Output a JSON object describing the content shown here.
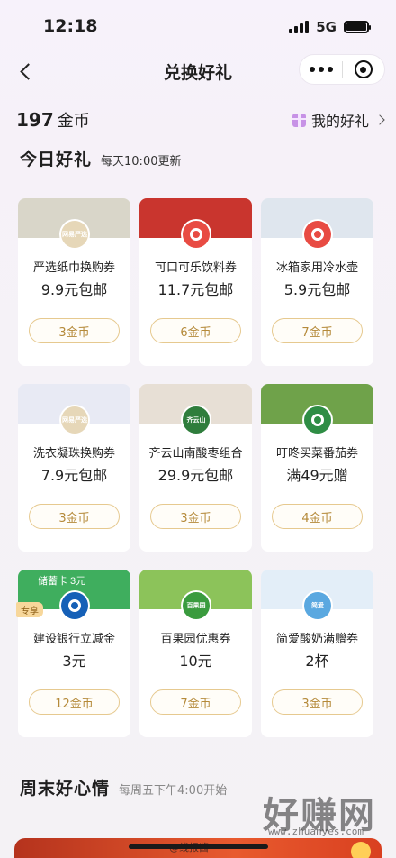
{
  "status_bar": {
    "time": "12:18",
    "network": "5G"
  },
  "nav": {
    "title": "兑换好礼"
  },
  "balance": {
    "amount": "197",
    "unit": "金币"
  },
  "my_gifts": {
    "label": "我的好礼"
  },
  "today": {
    "title": "今日好礼",
    "subtitle": "每天10:00更新"
  },
  "items": [
    {
      "name": "严选纸巾换购券",
      "price": "9.9元包邮",
      "cost": "3金币",
      "img_color": "#d9d6c9",
      "logo_color": "#e6d7b8",
      "logo": "网易严选"
    },
    {
      "name": "可口可乐饮料券",
      "price": "11.7元包邮",
      "cost": "6金币",
      "img_color": "#c9352e",
      "logo_color": "#e84b43",
      "logo": ""
    },
    {
      "name": "冰箱家用冷水壶",
      "price": "5.9元包邮",
      "cost": "7金币",
      "img_color": "#dfe6ee",
      "logo_color": "#e84b43",
      "logo": ""
    },
    {
      "name": "洗衣凝珠换购券",
      "price": "7.9元包邮",
      "cost": "3金币",
      "img_color": "#e8eaf4",
      "logo_color": "#e6d7b8",
      "logo": "网易严选"
    },
    {
      "name": "齐云山南酸枣组合",
      "price": "29.9元包邮",
      "cost": "3金币",
      "img_color": "#e7dfd5",
      "logo_color": "#2f7d3c",
      "logo": "齐云山"
    },
    {
      "name": "叮咚买菜番茄券",
      "price": "满49元赠",
      "cost": "4金币",
      "img_color": "#6fa24a",
      "logo_color": "#2f8d45",
      "logo": ""
    },
    {
      "name": "建设银行立减金",
      "price": "3元",
      "cost": "12金币",
      "img_color": "#3fae5e",
      "logo_color": "#1560b7",
      "logo": "",
      "tag": "专享",
      "img_text": "储蓄卡 3元"
    },
    {
      "name": "百果园优惠券",
      "price": "10元",
      "cost": "7金币",
      "img_color": "#8cc35a",
      "logo_color": "#3a9b3e",
      "logo": "百果园"
    },
    {
      "name": "简爱酸奶满赠券",
      "price": "2杯",
      "cost": "3金币",
      "img_color": "#e3eef8",
      "logo_color": "#5aa8e0",
      "logo": "简爱"
    }
  ],
  "weekend": {
    "title": "周末好心情",
    "subtitle": "每周五下午4:00开始"
  },
  "watermark": {
    "brand": "好赚网",
    "url": "www.zhuanyes.com",
    "weibo": "@线报酱"
  }
}
